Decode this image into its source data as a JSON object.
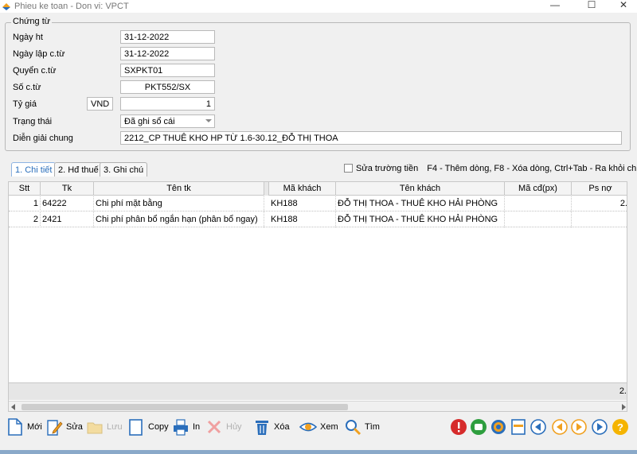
{
  "window": {
    "title": "Phieu ke toan - Don vi: VPCT",
    "minimize": "—",
    "maximize": "☐",
    "close": "✕"
  },
  "voucher": {
    "group_title": "Chứng từ",
    "ngay_ht_label": "Ngày ht",
    "ngay_ht": "31-12-2022",
    "ngay_lap_label": "Ngày lập c.từ",
    "ngay_lap": "31-12-2022",
    "quyen_label": "Quyển c.từ",
    "quyen": "SXPKT01",
    "so_label": "Số c.từ",
    "so": "PKT552/SX",
    "ty_gia_label": "Tỷ giá",
    "currency": "VND",
    "rate": "1",
    "trang_thai_label": "Trạng thái",
    "trang_thai": "Đã ghi sổ cái",
    "dien_giai_label": "Diễn giải chung",
    "dien_giai": "2212_CP THUÊ KHO HP TỪ 1.6-30.12_ĐỖ THỊ THOA"
  },
  "tabs": [
    {
      "label": "1. Chi tiết"
    },
    {
      "label": "2. Hđ thuế"
    },
    {
      "label": "3. Ghi chú"
    }
  ],
  "edit_money_label": "Sửa trường tiền",
  "shortcut_hint": "F4 - Thêm dòng, F8 - Xóa dòng, Ctrl+Tab - Ra khỏi chi tiết",
  "grid": {
    "columns": [
      "Stt",
      "Tk",
      "Tên tk",
      "Mã khách",
      "Tên khách",
      "Mã cđ(px)",
      "Ps nợ"
    ],
    "rows": [
      {
        "stt": "1",
        "tk": "64222",
        "ten_tk": "Chi phí mặt bằng",
        "ma_khach": "KH188",
        "ten_khach": "ĐỖ THỊ THOA - THUÊ KHO HẢI PHÒNG",
        "ma_cd": "",
        "ps_no": "2."
      },
      {
        "stt": "2",
        "tk": "2421",
        "ten_tk": "Chi phí phân bổ ngắn hạn (phân bổ ngay)",
        "ma_khach": "KH188",
        "ten_khach": "ĐỖ THỊ THOA - THUÊ KHO HẢI PHÒNG",
        "ma_cd": "",
        "ps_no": ""
      }
    ],
    "footer_total": "2."
  },
  "toolbar": {
    "new": "Mới",
    "edit": "Sửa",
    "save": "Lưu",
    "copy": "Copy",
    "print": "In",
    "cancel": "Hủy",
    "delete": "Xóa",
    "view": "Xem",
    "find": "Tìm"
  },
  "colors": {
    "accent_blue": "#2a6ebb",
    "red": "#d62b2b",
    "green": "#2e9e3e",
    "orange": "#f0a020",
    "help": "#f5b400"
  }
}
